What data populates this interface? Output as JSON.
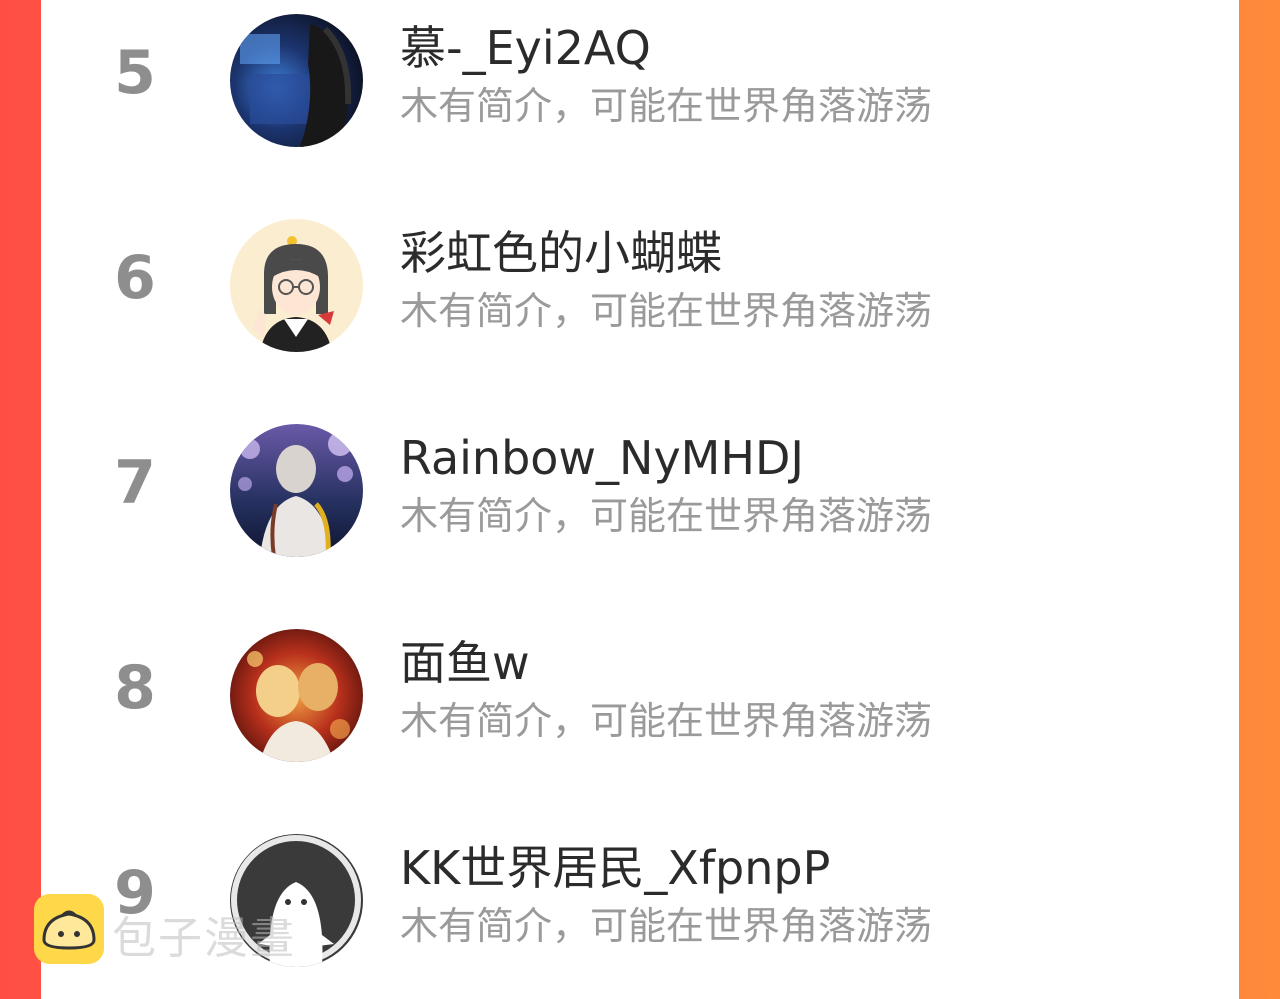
{
  "list": {
    "items": [
      {
        "rank": "5",
        "name": "慕-_Eyi2AQ",
        "bio": "木有简介，可能在世界角落游荡",
        "avatar_icon": "dark-room-photo-avatar"
      },
      {
        "rank": "6",
        "name": "彩虹色的小蝴蝶",
        "bio": "木有简介，可能在世界角落游荡",
        "avatar_icon": "cartoon-girl-glasses-avatar"
      },
      {
        "rank": "7",
        "name": "Rainbow_NyMHDJ",
        "bio": "木有简介，可能在世界角落游荡",
        "avatar_icon": "anime-character-avatar"
      },
      {
        "rank": "8",
        "name": "面鱼w",
        "bio": "木有简介，可能在世界角落游荡",
        "avatar_icon": "red-anime-avatar"
      },
      {
        "rank": "9",
        "name": "KK世界居民_XfpnpP",
        "bio": "木有简介，可能在世界角落游荡",
        "avatar_icon": "default-ghost-avatar"
      }
    ]
  },
  "watermark": {
    "text": "包子漫畫",
    "icon": "bun-logo-icon"
  },
  "colors": {
    "background_gradient_start": "#ff4f45",
    "background_gradient_end": "#ff8a3a",
    "rank_color": "#8e8e8e",
    "name_color": "#2b2b2b",
    "bio_color": "#9a9a9a",
    "logo_yellow": "#ffd84a"
  }
}
